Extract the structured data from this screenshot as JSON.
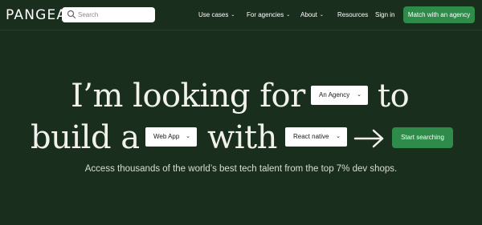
{
  "header": {
    "logo_text": "PANGEA",
    "search_placeholder": "Search",
    "nav": [
      {
        "label": "Use cases",
        "dropdown": true
      },
      {
        "label": "For agencies",
        "dropdown": true
      },
      {
        "label": "About",
        "dropdown": true
      },
      {
        "label": "Resources",
        "dropdown": false
      },
      {
        "label": "Sign in",
        "dropdown": false
      }
    ],
    "cta_label": "Match with an agency"
  },
  "hero": {
    "line1_prefix": "I’m looking for",
    "line1_suffix": "to",
    "line2_prefix": "build a",
    "line2_middle": "with",
    "select_role": "An Agency",
    "select_project": "Web App",
    "select_tech": "React native",
    "start_label": "Start searching",
    "subtitle": "Access thousands of the world’s best tech talent from the top 7% dev shops."
  },
  "colors": {
    "background": "#1a2e1e",
    "accent": "#2e8b4a",
    "hero_text": "#f2f2ec"
  }
}
